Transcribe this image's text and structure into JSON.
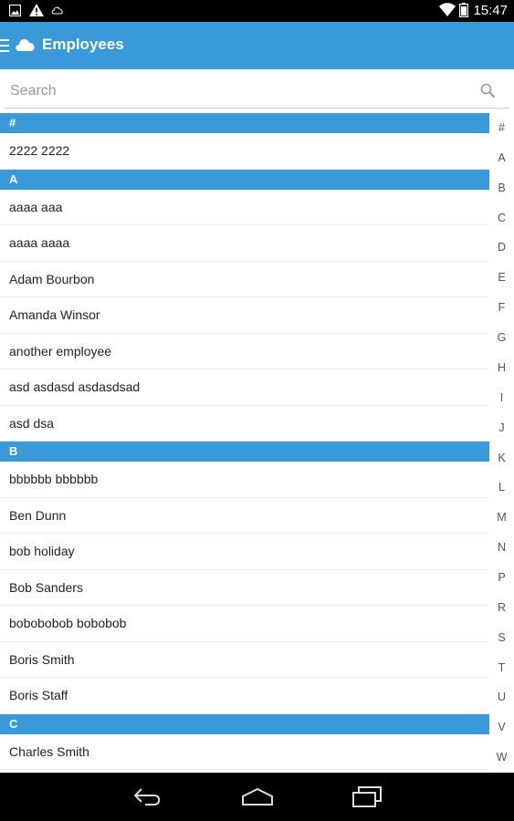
{
  "status_bar": {
    "time": "15:47",
    "icons": [
      "picture-icon",
      "warning-icon",
      "cloud-outline-icon",
      "wifi-icon",
      "battery-icon"
    ]
  },
  "action_bar": {
    "title": "Employees",
    "icons": [
      "menu-icon",
      "cloud-icon"
    ],
    "background": "#3a9ad9"
  },
  "search": {
    "placeholder": "Search",
    "value": ""
  },
  "sections": [
    {
      "header": "#",
      "items": [
        "2222 2222"
      ]
    },
    {
      "header": "A",
      "items": [
        "aaaa aaa",
        "aaaa aaaa",
        "Adam Bourbon",
        "Amanda Winsor",
        "another employee",
        "asd asdasd asdasdsad",
        "asd dsa"
      ]
    },
    {
      "header": "B",
      "items": [
        "bbbbbb bbbbbb",
        "Ben Dunn",
        "bob holiday",
        "Bob Sanders",
        "bobobobob bobobob",
        "Boris Smith",
        "Boris Staff"
      ]
    },
    {
      "header": "C",
      "items": [
        "Charles Smith"
      ]
    }
  ],
  "alpha_index": [
    "#",
    "A",
    "B",
    "C",
    "D",
    "E",
    "F",
    "G",
    "H",
    "I",
    "J",
    "K",
    "L",
    "M",
    "N",
    "P",
    "R",
    "S",
    "T",
    "U",
    "V",
    "W"
  ],
  "nav_bar": {
    "buttons": [
      "back-icon",
      "home-icon",
      "recent-apps-icon"
    ]
  }
}
